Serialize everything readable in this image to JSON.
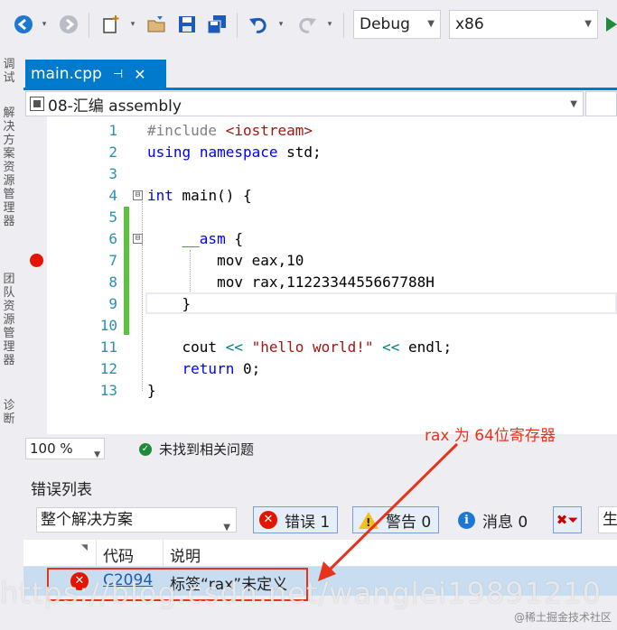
{
  "toolbar": {
    "config": "Debug",
    "platform": "x86"
  },
  "side_strip": {
    "labels": [
      "调试",
      "解决方案资源管理器",
      "团队资源管理器",
      "诊断"
    ]
  },
  "tab": {
    "filename": "main.cpp",
    "pin": "⊣",
    "close": "✕"
  },
  "navbar": {
    "project": "08-汇编 assembly"
  },
  "editor": {
    "line_numbers": [
      "1",
      "2",
      "3",
      "4",
      "5",
      "6",
      "7",
      "8",
      "9",
      "10",
      "11",
      "12",
      "13"
    ],
    "fold_markers": [
      "⊟",
      "⊟"
    ],
    "code": {
      "l1_pp": "#include ",
      "l1_inc": "<iostream>",
      "l2_kw1": "using",
      "l2_kw2": "namespace",
      "l2_rest": " std;",
      "l4_kw": "int",
      "l4_rest": " main() {",
      "l6_kw": "__asm",
      "l6_rest": " {",
      "l7": "mov eax,10",
      "l8": "mov rax,1122334455667788H",
      "l9": "}",
      "l11_a": "cout ",
      "l11_op1": "<<",
      "l11_str": " \"hello world!\" ",
      "l11_op2": "<<",
      "l11_b": " endl;",
      "l12_kw": "return",
      "l12_rest": " 0;",
      "l13": "}"
    }
  },
  "status": {
    "zoom": "100 %",
    "issues": "未找到相关问题"
  },
  "annotation": "rax 为 64位寄存器",
  "error_list": {
    "title": "错误列表",
    "scope": "整个解决方案",
    "errors_label": "错误 1",
    "warnings_label": "警告 0",
    "messages_label": "消息 0",
    "build_label": "生",
    "col_code": "代码",
    "col_desc": "说明",
    "rows": [
      {
        "code": "C2094",
        "description": "标签“rax”未定义"
      }
    ]
  },
  "watermark": "https://blog.csdn.net/wanglei19891210",
  "corner_mark": "@稀土掘金技术社区",
  "colors": {
    "accent": "#007acc",
    "breakpoint": "#e51400",
    "annotation": "#e8331c",
    "keyword": "#0000ff",
    "string": "#a31515",
    "line_number": "#2b91af"
  }
}
